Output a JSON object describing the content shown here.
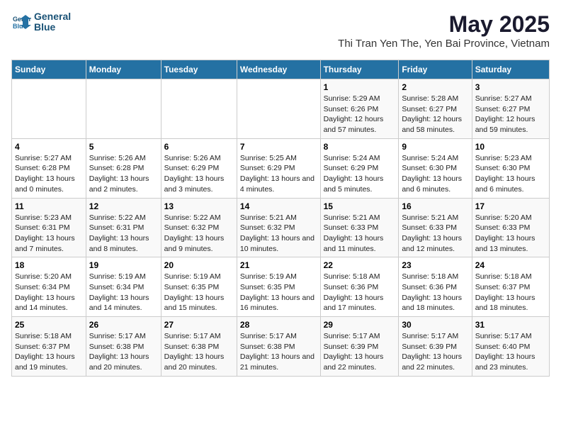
{
  "logo": {
    "line1": "General",
    "line2": "Blue"
  },
  "header": {
    "month": "May 2025",
    "location": "Thi Tran Yen The, Yen Bai Province, Vietnam"
  },
  "weekdays": [
    "Sunday",
    "Monday",
    "Tuesday",
    "Wednesday",
    "Thursday",
    "Friday",
    "Saturday"
  ],
  "weeks": [
    [
      {
        "day": "",
        "info": ""
      },
      {
        "day": "",
        "info": ""
      },
      {
        "day": "",
        "info": ""
      },
      {
        "day": "",
        "info": ""
      },
      {
        "day": "1",
        "info": "Sunrise: 5:29 AM\nSunset: 6:26 PM\nDaylight: 12 hours and 57 minutes."
      },
      {
        "day": "2",
        "info": "Sunrise: 5:28 AM\nSunset: 6:27 PM\nDaylight: 12 hours and 58 minutes."
      },
      {
        "day": "3",
        "info": "Sunrise: 5:27 AM\nSunset: 6:27 PM\nDaylight: 12 hours and 59 minutes."
      }
    ],
    [
      {
        "day": "4",
        "info": "Sunrise: 5:27 AM\nSunset: 6:28 PM\nDaylight: 13 hours and 0 minutes."
      },
      {
        "day": "5",
        "info": "Sunrise: 5:26 AM\nSunset: 6:28 PM\nDaylight: 13 hours and 2 minutes."
      },
      {
        "day": "6",
        "info": "Sunrise: 5:26 AM\nSunset: 6:29 PM\nDaylight: 13 hours and 3 minutes."
      },
      {
        "day": "7",
        "info": "Sunrise: 5:25 AM\nSunset: 6:29 PM\nDaylight: 13 hours and 4 minutes."
      },
      {
        "day": "8",
        "info": "Sunrise: 5:24 AM\nSunset: 6:29 PM\nDaylight: 13 hours and 5 minutes."
      },
      {
        "day": "9",
        "info": "Sunrise: 5:24 AM\nSunset: 6:30 PM\nDaylight: 13 hours and 6 minutes."
      },
      {
        "day": "10",
        "info": "Sunrise: 5:23 AM\nSunset: 6:30 PM\nDaylight: 13 hours and 6 minutes."
      }
    ],
    [
      {
        "day": "11",
        "info": "Sunrise: 5:23 AM\nSunset: 6:31 PM\nDaylight: 13 hours and 7 minutes."
      },
      {
        "day": "12",
        "info": "Sunrise: 5:22 AM\nSunset: 6:31 PM\nDaylight: 13 hours and 8 minutes."
      },
      {
        "day": "13",
        "info": "Sunrise: 5:22 AM\nSunset: 6:32 PM\nDaylight: 13 hours and 9 minutes."
      },
      {
        "day": "14",
        "info": "Sunrise: 5:21 AM\nSunset: 6:32 PM\nDaylight: 13 hours and 10 minutes."
      },
      {
        "day": "15",
        "info": "Sunrise: 5:21 AM\nSunset: 6:33 PM\nDaylight: 13 hours and 11 minutes."
      },
      {
        "day": "16",
        "info": "Sunrise: 5:21 AM\nSunset: 6:33 PM\nDaylight: 13 hours and 12 minutes."
      },
      {
        "day": "17",
        "info": "Sunrise: 5:20 AM\nSunset: 6:33 PM\nDaylight: 13 hours and 13 minutes."
      }
    ],
    [
      {
        "day": "18",
        "info": "Sunrise: 5:20 AM\nSunset: 6:34 PM\nDaylight: 13 hours and 14 minutes."
      },
      {
        "day": "19",
        "info": "Sunrise: 5:19 AM\nSunset: 6:34 PM\nDaylight: 13 hours and 14 minutes."
      },
      {
        "day": "20",
        "info": "Sunrise: 5:19 AM\nSunset: 6:35 PM\nDaylight: 13 hours and 15 minutes."
      },
      {
        "day": "21",
        "info": "Sunrise: 5:19 AM\nSunset: 6:35 PM\nDaylight: 13 hours and 16 minutes."
      },
      {
        "day": "22",
        "info": "Sunrise: 5:18 AM\nSunset: 6:36 PM\nDaylight: 13 hours and 17 minutes."
      },
      {
        "day": "23",
        "info": "Sunrise: 5:18 AM\nSunset: 6:36 PM\nDaylight: 13 hours and 18 minutes."
      },
      {
        "day": "24",
        "info": "Sunrise: 5:18 AM\nSunset: 6:37 PM\nDaylight: 13 hours and 18 minutes."
      }
    ],
    [
      {
        "day": "25",
        "info": "Sunrise: 5:18 AM\nSunset: 6:37 PM\nDaylight: 13 hours and 19 minutes."
      },
      {
        "day": "26",
        "info": "Sunrise: 5:17 AM\nSunset: 6:38 PM\nDaylight: 13 hours and 20 minutes."
      },
      {
        "day": "27",
        "info": "Sunrise: 5:17 AM\nSunset: 6:38 PM\nDaylight: 13 hours and 20 minutes."
      },
      {
        "day": "28",
        "info": "Sunrise: 5:17 AM\nSunset: 6:38 PM\nDaylight: 13 hours and 21 minutes."
      },
      {
        "day": "29",
        "info": "Sunrise: 5:17 AM\nSunset: 6:39 PM\nDaylight: 13 hours and 22 minutes."
      },
      {
        "day": "30",
        "info": "Sunrise: 5:17 AM\nSunset: 6:39 PM\nDaylight: 13 hours and 22 minutes."
      },
      {
        "day": "31",
        "info": "Sunrise: 5:17 AM\nSunset: 6:40 PM\nDaylight: 13 hours and 23 minutes."
      }
    ]
  ]
}
